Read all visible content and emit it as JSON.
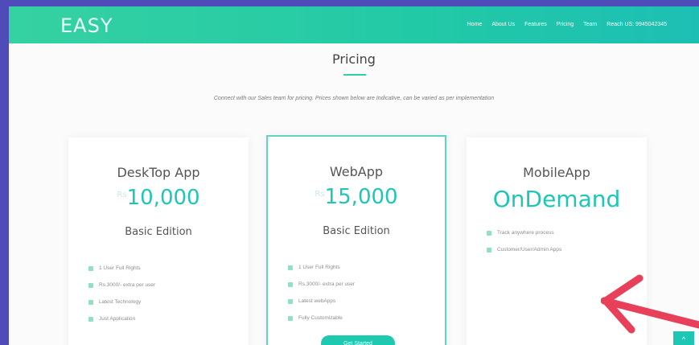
{
  "brand": {
    "logo": "EASY"
  },
  "nav": {
    "items": [
      "Home",
      "About Us",
      "Features",
      "Pricing",
      "Team",
      "Reach US: 9945042345"
    ]
  },
  "pricing": {
    "title": "Pricing",
    "subtitle": "Connect with our Sales team for pricing. Prices shown below are Indicative, can be varied as per implementation",
    "plans": [
      {
        "name": "DeskTop App",
        "currency": "Rs",
        "price": "10,000",
        "edition": "Basic Edition",
        "features": [
          "1 User Full Rights",
          "Rs.3000/- extra per user",
          "Latest Technology",
          "Just Application"
        ]
      },
      {
        "name": "WebApp",
        "currency": "Rs",
        "price": "15,000",
        "edition": "Basic Edition",
        "features": [
          "1 User Full Rights",
          "Rs.3000/- extra per user",
          "Latest webApps",
          "Fully Customizable"
        ],
        "cta": "Get Started"
      },
      {
        "name": "MobileApp",
        "price": "OnDemand",
        "features": [
          "Track anywhere process",
          "Customer/User/Admin Apps"
        ]
      }
    ]
  },
  "colors": {
    "accent": "#1cc7b5",
    "frame": "#4f4bb8",
    "arrow": "#e8405a"
  },
  "icons": {
    "feature": "check-icon",
    "arrow": "red-arrow-icon",
    "scroll": "chevron-up-icon"
  },
  "scroll_top_glyph": "^"
}
